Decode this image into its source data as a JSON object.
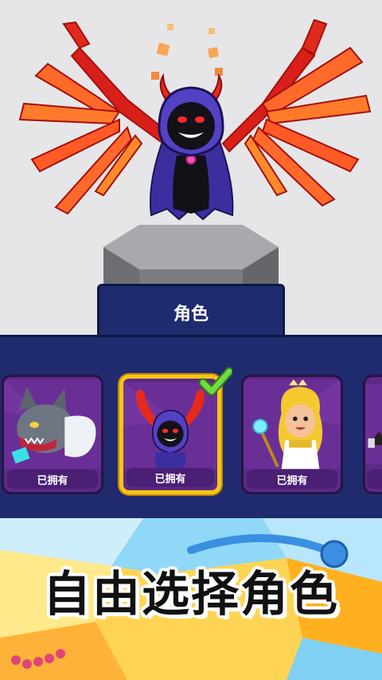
{
  "stage": {
    "character": "reaper-demon",
    "background_color": "#e6e6e8"
  },
  "tab": {
    "label": "角色"
  },
  "cards": [
    {
      "character": "werewolf",
      "status": "已拥有",
      "selected": false
    },
    {
      "character": "reaper-demon",
      "status": "已拥有",
      "selected": true
    },
    {
      "character": "golden-girl",
      "status": "已拥有",
      "selected": false
    },
    {
      "character": "partial-fourth",
      "status": "",
      "selected": false
    }
  ],
  "banner": {
    "text": "自由选择角色"
  },
  "colors": {
    "panel": "#1f2b6e",
    "card": "#5b2a86",
    "selected_border": "#f8c515",
    "check": "#5ecb3a"
  }
}
